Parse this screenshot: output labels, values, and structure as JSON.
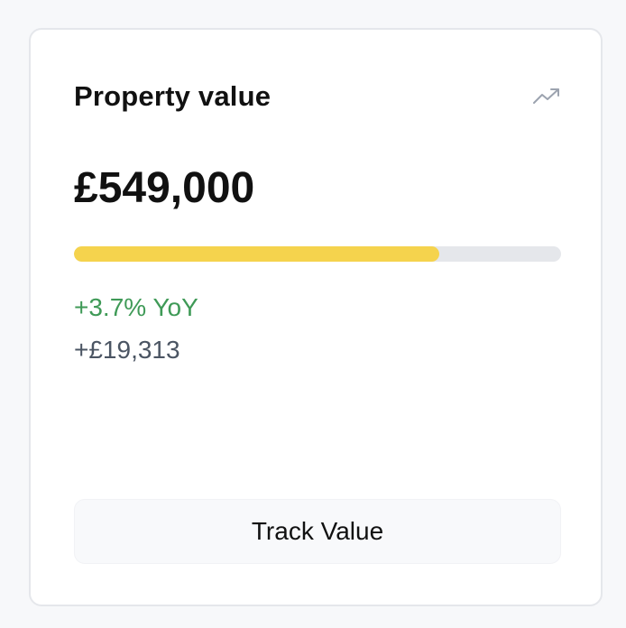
{
  "card": {
    "title": "Property value",
    "trend_icon": "trending-up-icon",
    "value": "£549,000",
    "progress_fraction": 0.75,
    "change_percent": "+3.7% YoY",
    "change_amount": "+£19,313",
    "button_label": "Track Value"
  },
  "colors": {
    "accent_fill": "#f5d34d",
    "track": "#e5e7eb",
    "positive": "#3f9a57",
    "muted_text": "#4b5563"
  }
}
